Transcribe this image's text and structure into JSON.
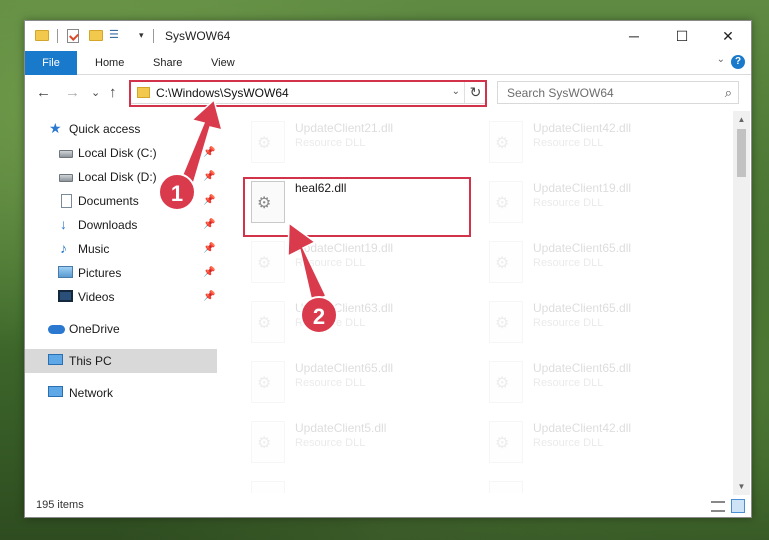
{
  "window": {
    "title": "SysWOW64",
    "minimize": "─",
    "maximize": "☐",
    "close": "✕"
  },
  "quick_access_toolbar": {
    "view_icon": "☰",
    "dropdown": "▾"
  },
  "ribbon": {
    "tabs": [
      "File",
      "Home",
      "Share",
      "View"
    ],
    "expand": "⌄",
    "help": "?"
  },
  "nav": {
    "back": "←",
    "forward": "→",
    "recent": "⌄",
    "up": "↑",
    "address": "C:\\Windows\\SysWOW64",
    "address_dropdown": "⌄",
    "refresh": "↻",
    "search_placeholder": "Search SysWOW64",
    "search_icon": "⌕"
  },
  "sidebar": {
    "items": [
      {
        "label": "Quick access",
        "icon": "star-icon",
        "pinned": false
      },
      {
        "label": "Local Disk (C:)",
        "icon": "disk-icon",
        "pinned": true
      },
      {
        "label": "Local Disk (D:)",
        "icon": "disk-icon",
        "pinned": true
      },
      {
        "label": "Documents",
        "icon": "documents-icon",
        "pinned": true
      },
      {
        "label": "Downloads",
        "icon": "download-icon",
        "pinned": true
      },
      {
        "label": "Music",
        "icon": "music-icon",
        "pinned": true
      },
      {
        "label": "Pictures",
        "icon": "pictures-icon",
        "pinned": true
      },
      {
        "label": "Videos",
        "icon": "videos-icon",
        "pinned": true
      },
      {
        "label": "OneDrive",
        "icon": "onedrive-icon",
        "pinned": false
      },
      {
        "label": "This PC",
        "icon": "pc-icon",
        "pinned": false,
        "selected": true
      },
      {
        "label": "Network",
        "icon": "network-icon",
        "pinned": false
      }
    ],
    "pin_glyph": "📌"
  },
  "files": {
    "left": [
      {
        "name": "UpdateClient21.dll",
        "type": "Resource DLL"
      },
      {
        "name": "heal62.dll",
        "type": ""
      },
      {
        "name": "UpdateClient19.dll",
        "type": "Resource DLL"
      },
      {
        "name": "UpdateClient63.dll",
        "type": "Resource DLL"
      },
      {
        "name": "UpdateClient65.dll",
        "type": "Resource DLL"
      },
      {
        "name": "UpdateClient5.dll",
        "type": "Resource DLL"
      },
      {
        "name": "",
        "type": ""
      }
    ],
    "right": [
      {
        "name": "UpdateClient42.dll",
        "type": "Resource DLL"
      },
      {
        "name": "UpdateClient19.dll",
        "type": "Resource DLL"
      },
      {
        "name": "UpdateClient65.dll",
        "type": "Resource DLL"
      },
      {
        "name": "UpdateClient65.dll",
        "type": "Resource DLL"
      },
      {
        "name": "UpdateClient65.dll",
        "type": "Resource DLL"
      },
      {
        "name": "UpdateClient42.dll",
        "type": "Resource DLL"
      },
      {
        "name": "",
        "type": ""
      }
    ]
  },
  "status": {
    "item_count": "195 items"
  },
  "annotations": {
    "step1": "1",
    "step2": "2",
    "highlight_color": "#d2334b",
    "badge_color": "#d93b4c"
  },
  "colors": {
    "accent": "#1979ca"
  }
}
